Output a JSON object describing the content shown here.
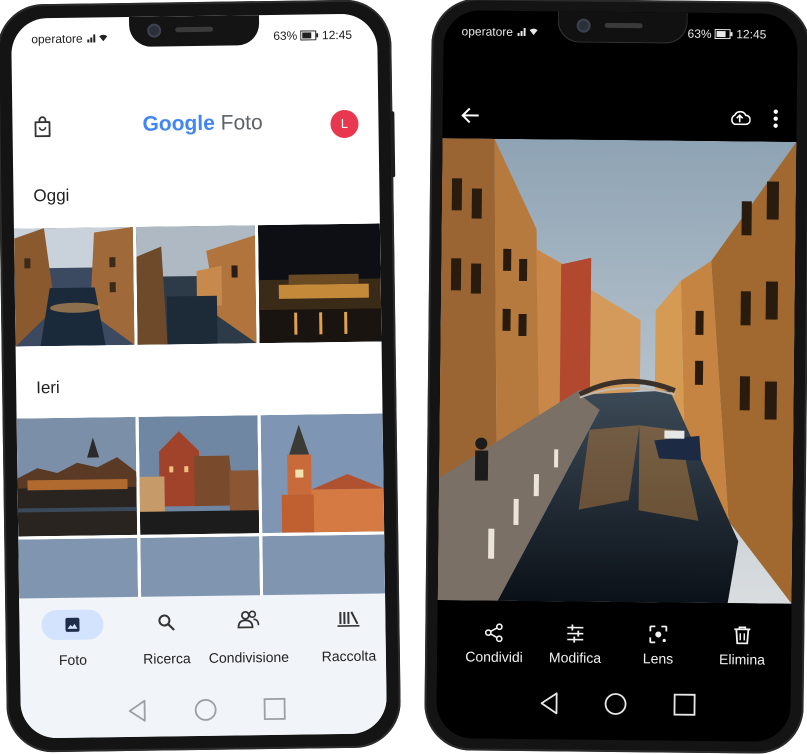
{
  "left_phone": {
    "status": {
      "carrier": "operatore",
      "battery": "63%",
      "time": "12:45"
    },
    "header": {
      "logo_google": "Google",
      "logo_foto": "Foto",
      "avatar_letter": "L"
    },
    "sections": [
      {
        "title": "Oggi"
      },
      {
        "title": "Ieri"
      }
    ],
    "bottom_nav": [
      {
        "label": "Foto",
        "icon": "photo-icon"
      },
      {
        "label": "Ricerca",
        "icon": "search-icon"
      },
      {
        "label": "Condivisione",
        "icon": "people-icon"
      },
      {
        "label": "Raccolta",
        "icon": "library-icon"
      }
    ],
    "system_nav": [
      "back-icon",
      "home-icon",
      "recents-icon"
    ],
    "colors": {
      "accent": "#1a73e8",
      "avatar": "#e8384f",
      "active_pill": "#d3e3fd"
    }
  },
  "right_phone": {
    "status": {
      "carrier": "operatore",
      "battery": "63%",
      "time": "12:45"
    },
    "top_bar": {
      "back": "arrow-back-icon",
      "backup": "cloud-upload-icon",
      "more": "more-vert-icon"
    },
    "actions": [
      {
        "label": "Condividi",
        "icon": "share-icon"
      },
      {
        "label": "Modifica",
        "icon": "tune-icon"
      },
      {
        "label": "Lens",
        "icon": "lens-icon"
      },
      {
        "label": "Elimina",
        "icon": "trash-icon"
      }
    ],
    "system_nav": [
      "back-icon",
      "home-icon",
      "recents-icon"
    ]
  }
}
